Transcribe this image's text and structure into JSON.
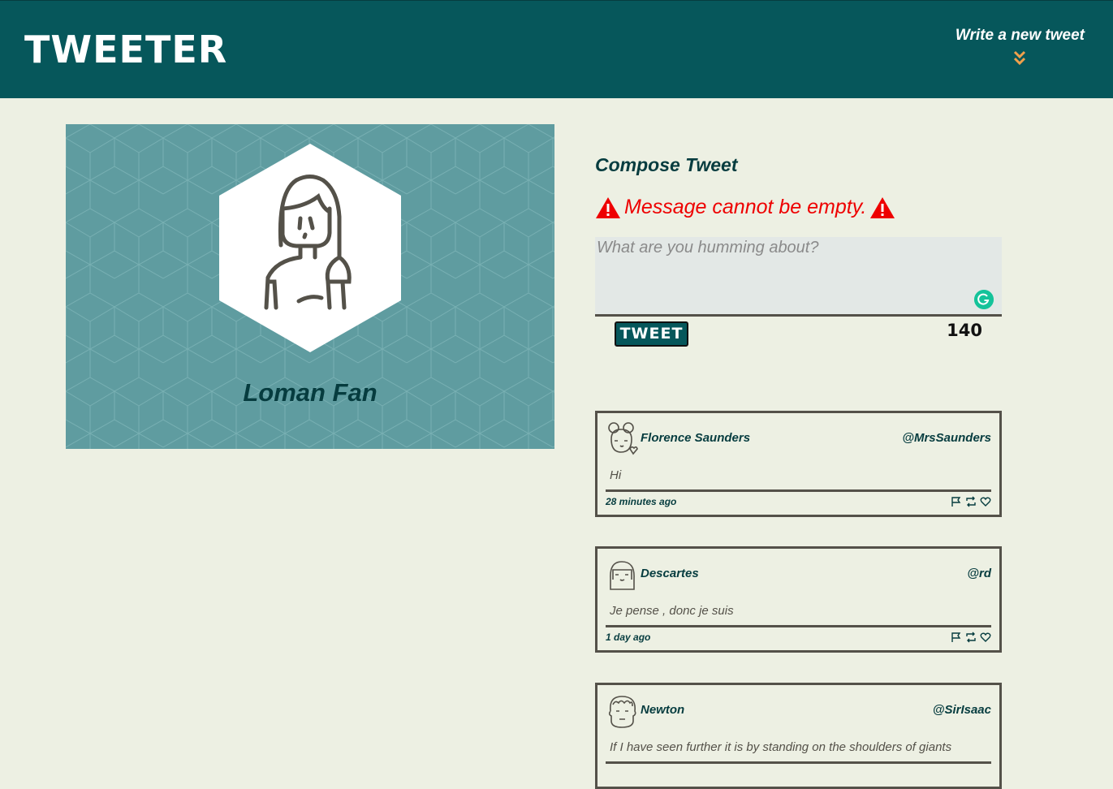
{
  "header": {
    "brand": "TWEETER",
    "write_label": "Write a new tweet"
  },
  "profile": {
    "name": "Loman Fan"
  },
  "compose": {
    "title": "Compose Tweet",
    "error": "Message cannot be empty.",
    "placeholder": "What are you humming about?",
    "button_label": "TWEET",
    "counter": "140"
  },
  "tweets": [
    {
      "name": "Florence Saunders",
      "handle": "@MrsSaunders",
      "body": "Hi",
      "time": "28 minutes ago"
    },
    {
      "name": "Descartes",
      "handle": "@rd",
      "body": "Je pense , donc je suis",
      "time": "1 day ago"
    },
    {
      "name": "Newton",
      "handle": "@SirIsaac",
      "body": "If I have seen further it is by standing on the shoulders of giants",
      "time": ""
    }
  ],
  "colors": {
    "header_bg": "#06575b",
    "page_bg": "#edf0e3",
    "profile_bg": "#5f9ca0",
    "error": "#ee0000",
    "accent_chevron": "#f0a04b"
  }
}
